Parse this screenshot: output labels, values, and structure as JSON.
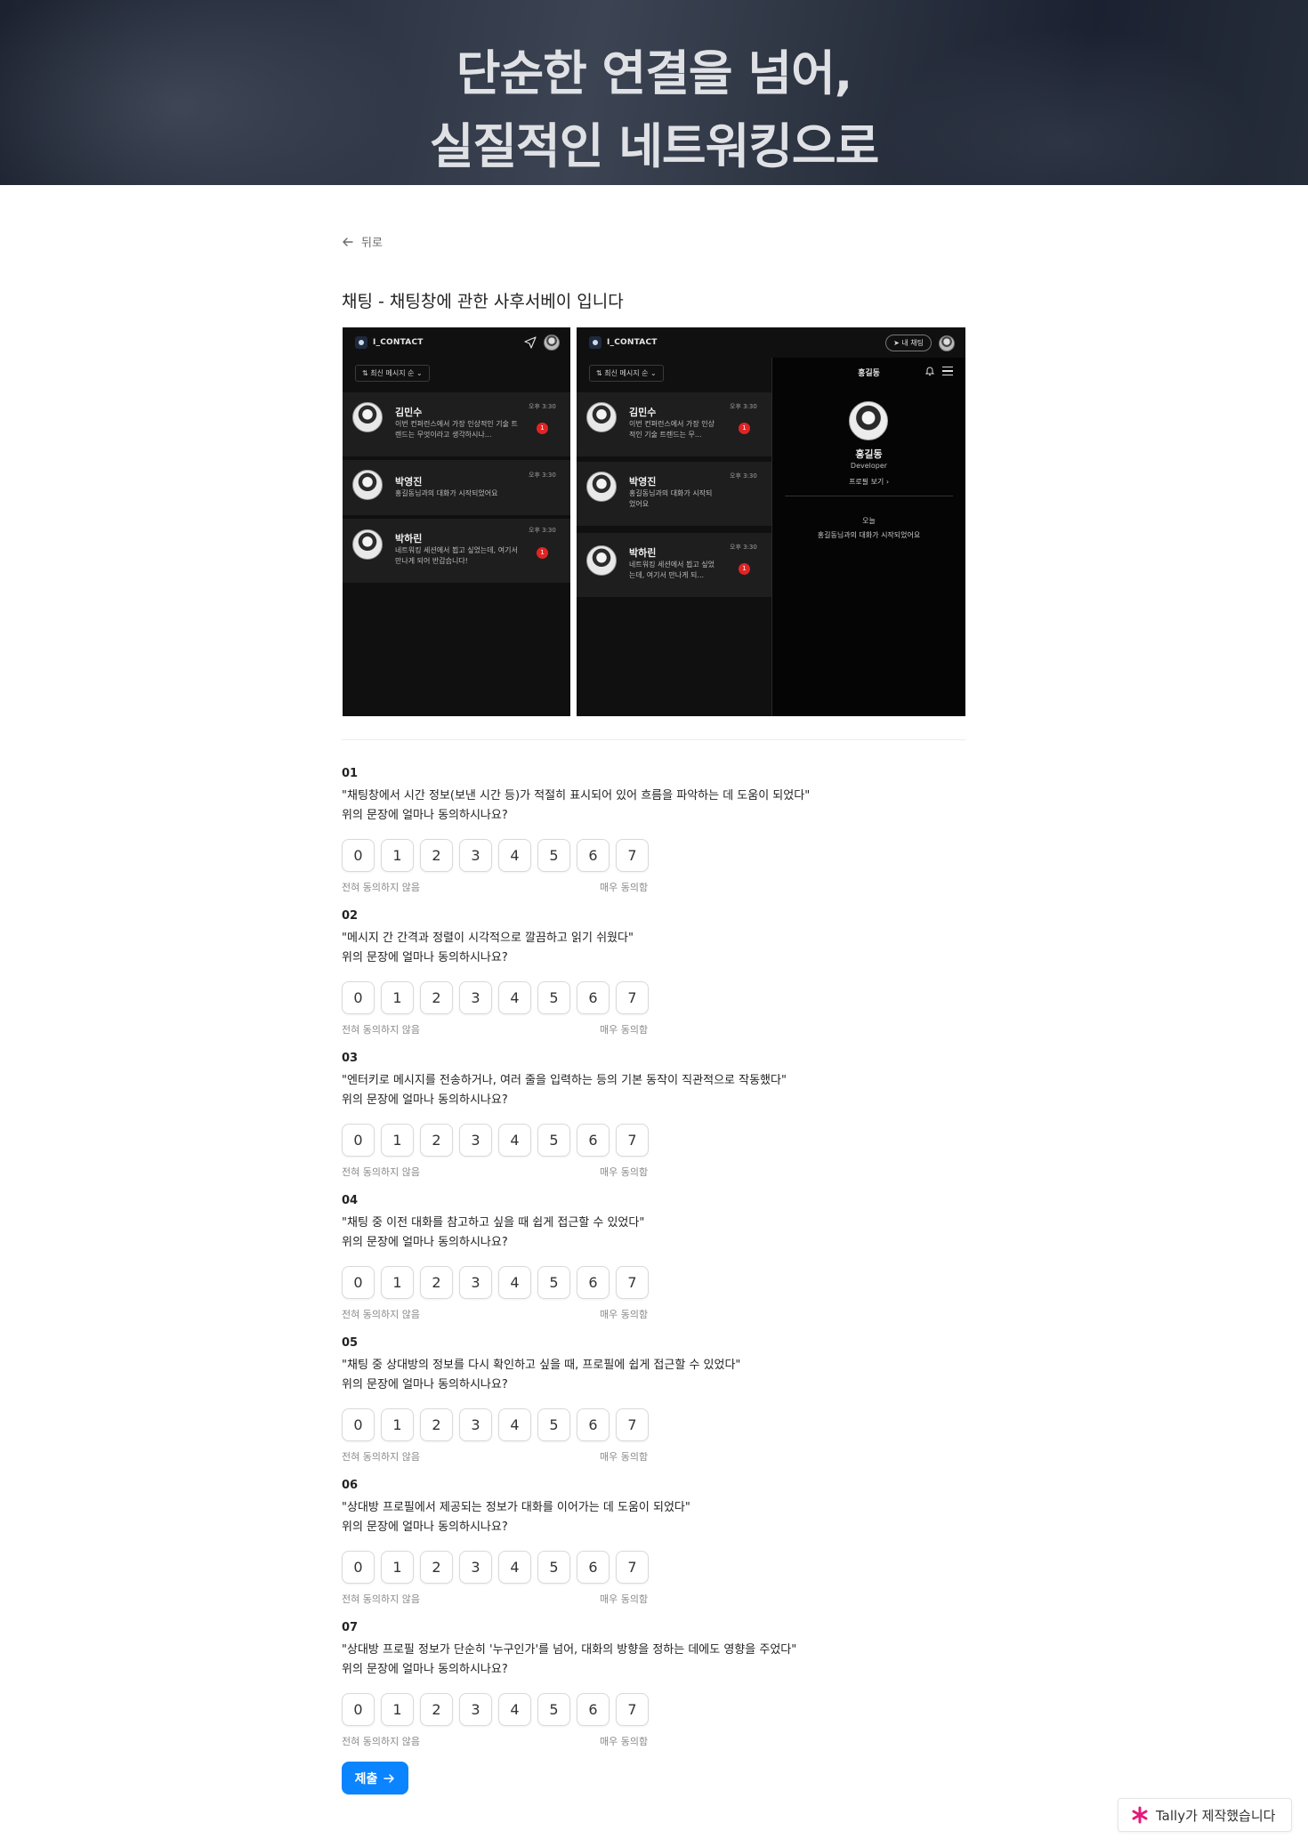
{
  "hero": {
    "line1": "단순한 연결을 넘어,",
    "line2": "실질적인 네트워킹으로"
  },
  "nav": {
    "back_label": "뒤로"
  },
  "form": {
    "title": "채팅 - 채팅창에 관한 사후서베이 입니다"
  },
  "mockup": {
    "app_name": "I_CONTACT",
    "sort_label": "⇅ 최신 메시지 순 ⌄",
    "my_chat_label": "내 채팅",
    "chats_narrow": [
      {
        "name": "김민수",
        "preview": "이번 컨퍼런스에서 가장 인상적인 기술 트렌드는 무엇이라고 생각하시나...",
        "time": "오후 3:30",
        "badge": "1"
      },
      {
        "name": "박영진",
        "preview": "홍길동님과의 대화가 시작되었어요",
        "time": "오후 3:30",
        "badge": ""
      },
      {
        "name": "박하린",
        "preview": "네트워킹 세션에서 뵙고 싶었는데, 여기서 만나게 되어 반갑습니다!",
        "time": "오후 3:30",
        "badge": "1"
      }
    ],
    "chats_wide": [
      {
        "name": "김민수",
        "preview": "이번 컨퍼런스에서 가장 인상적인 기술 트렌드는 무...",
        "time": "오후 3:30",
        "badge": "1"
      },
      {
        "name": "박영진",
        "preview": "홍길동님과의 대화가 시작되었어요",
        "time": "오후 3:30",
        "badge": ""
      },
      {
        "name": "박하린",
        "preview": "네트워킹 세션에서 뵙고 싶었는데, 여기서 만나게 되...",
        "time": "오후 3:30",
        "badge": "1"
      }
    ],
    "profile": {
      "header_name": "홍길동",
      "name": "홍길동",
      "role": "Developer",
      "view_profile": "프로필 보기 ›",
      "day": "오늘",
      "system_message": "홍길동님과의 대화가 시작되었어요"
    }
  },
  "scale": {
    "options": [
      "0",
      "1",
      "2",
      "3",
      "4",
      "5",
      "6",
      "7"
    ],
    "label_low": "전혀 동의하지 않음",
    "label_high": "매우 동의함",
    "sub_question": "위의  문장에 얼마나 동의하시나요?"
  },
  "questions": [
    {
      "num": "01",
      "text": "\"채팅창에서 시간 정보(보낸 시간 등)가 적절히 표시되어 있어 흐름을 파악하는 데 도움이 되었다\""
    },
    {
      "num": "02",
      "text": "\"메시지 간 간격과 정렬이 시각적으로 깔끔하고 읽기 쉬웠다\""
    },
    {
      "num": "03",
      "text": "\"엔터키로 메시지를 전송하거나, 여러 줄을 입력하는 등의 기본 동작이 직관적으로 작동했다\""
    },
    {
      "num": "04",
      "text": "\"채팅 중 이전 대화를 참고하고 싶을 때 쉽게 접근할 수 있었다\""
    },
    {
      "num": "05",
      "text": "\"채팅 중 상대방의 정보를 다시 확인하고 싶을 때, 프로필에 쉽게 접근할 수 있었다\""
    },
    {
      "num": "06",
      "text": "\"상대방 프로필에서 제공되는 정보가 대화를 이어가는 데 도움이 되었다\""
    },
    {
      "num": "07",
      "text": "\"상대방 프로필 정보가 단순히 '누구인가'를 넘어, 대화의 방향을 정하는 데에도 영향을 주었다\""
    }
  ],
  "submit": {
    "label": "제출"
  },
  "footer": {
    "tally_label": "Tally가 제작했습니다"
  },
  "colors": {
    "accent": "#0a84ff",
    "badge": "#e02424",
    "tally_star": "#e6197a"
  }
}
